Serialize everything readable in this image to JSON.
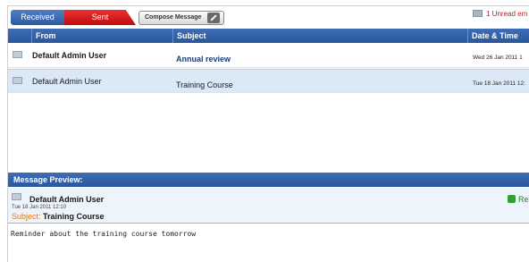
{
  "toolbar": {
    "tab_received": "Received",
    "tab_sent": "Sent",
    "compose_label": "Compose Message",
    "unread_text": "1 Unread em"
  },
  "grid": {
    "headers": {
      "from": "From",
      "subject": "Subject",
      "date": "Date & Time"
    },
    "rows": [
      {
        "from": "Default Admin User",
        "subject": "Annual review",
        "date": "Wed 26 Jan 2011 1"
      },
      {
        "from": "Default Admin User",
        "subject": "Training Course",
        "date": "Tue 18 Jan 2011 12:"
      }
    ]
  },
  "preview": {
    "title": "Message Preview:",
    "sender": "Default Admin User",
    "date": "Tue 18 Jan 2011 12:10",
    "subject_label": "Subject:",
    "subject": "Training Course",
    "reply_label": "Re",
    "body": "Reminder about the training course tomorrow"
  },
  "colors": {
    "header_blue": "#2f5fa8",
    "sent_red": "#d41a1a",
    "unread_red": "#c4161c",
    "selected_row": "#dbe9f7",
    "subject_label_orange": "#e07b16"
  },
  "icons": {
    "envelope": "envelope-icon",
    "pencil": "pencil-icon",
    "reply": "reply-icon"
  }
}
